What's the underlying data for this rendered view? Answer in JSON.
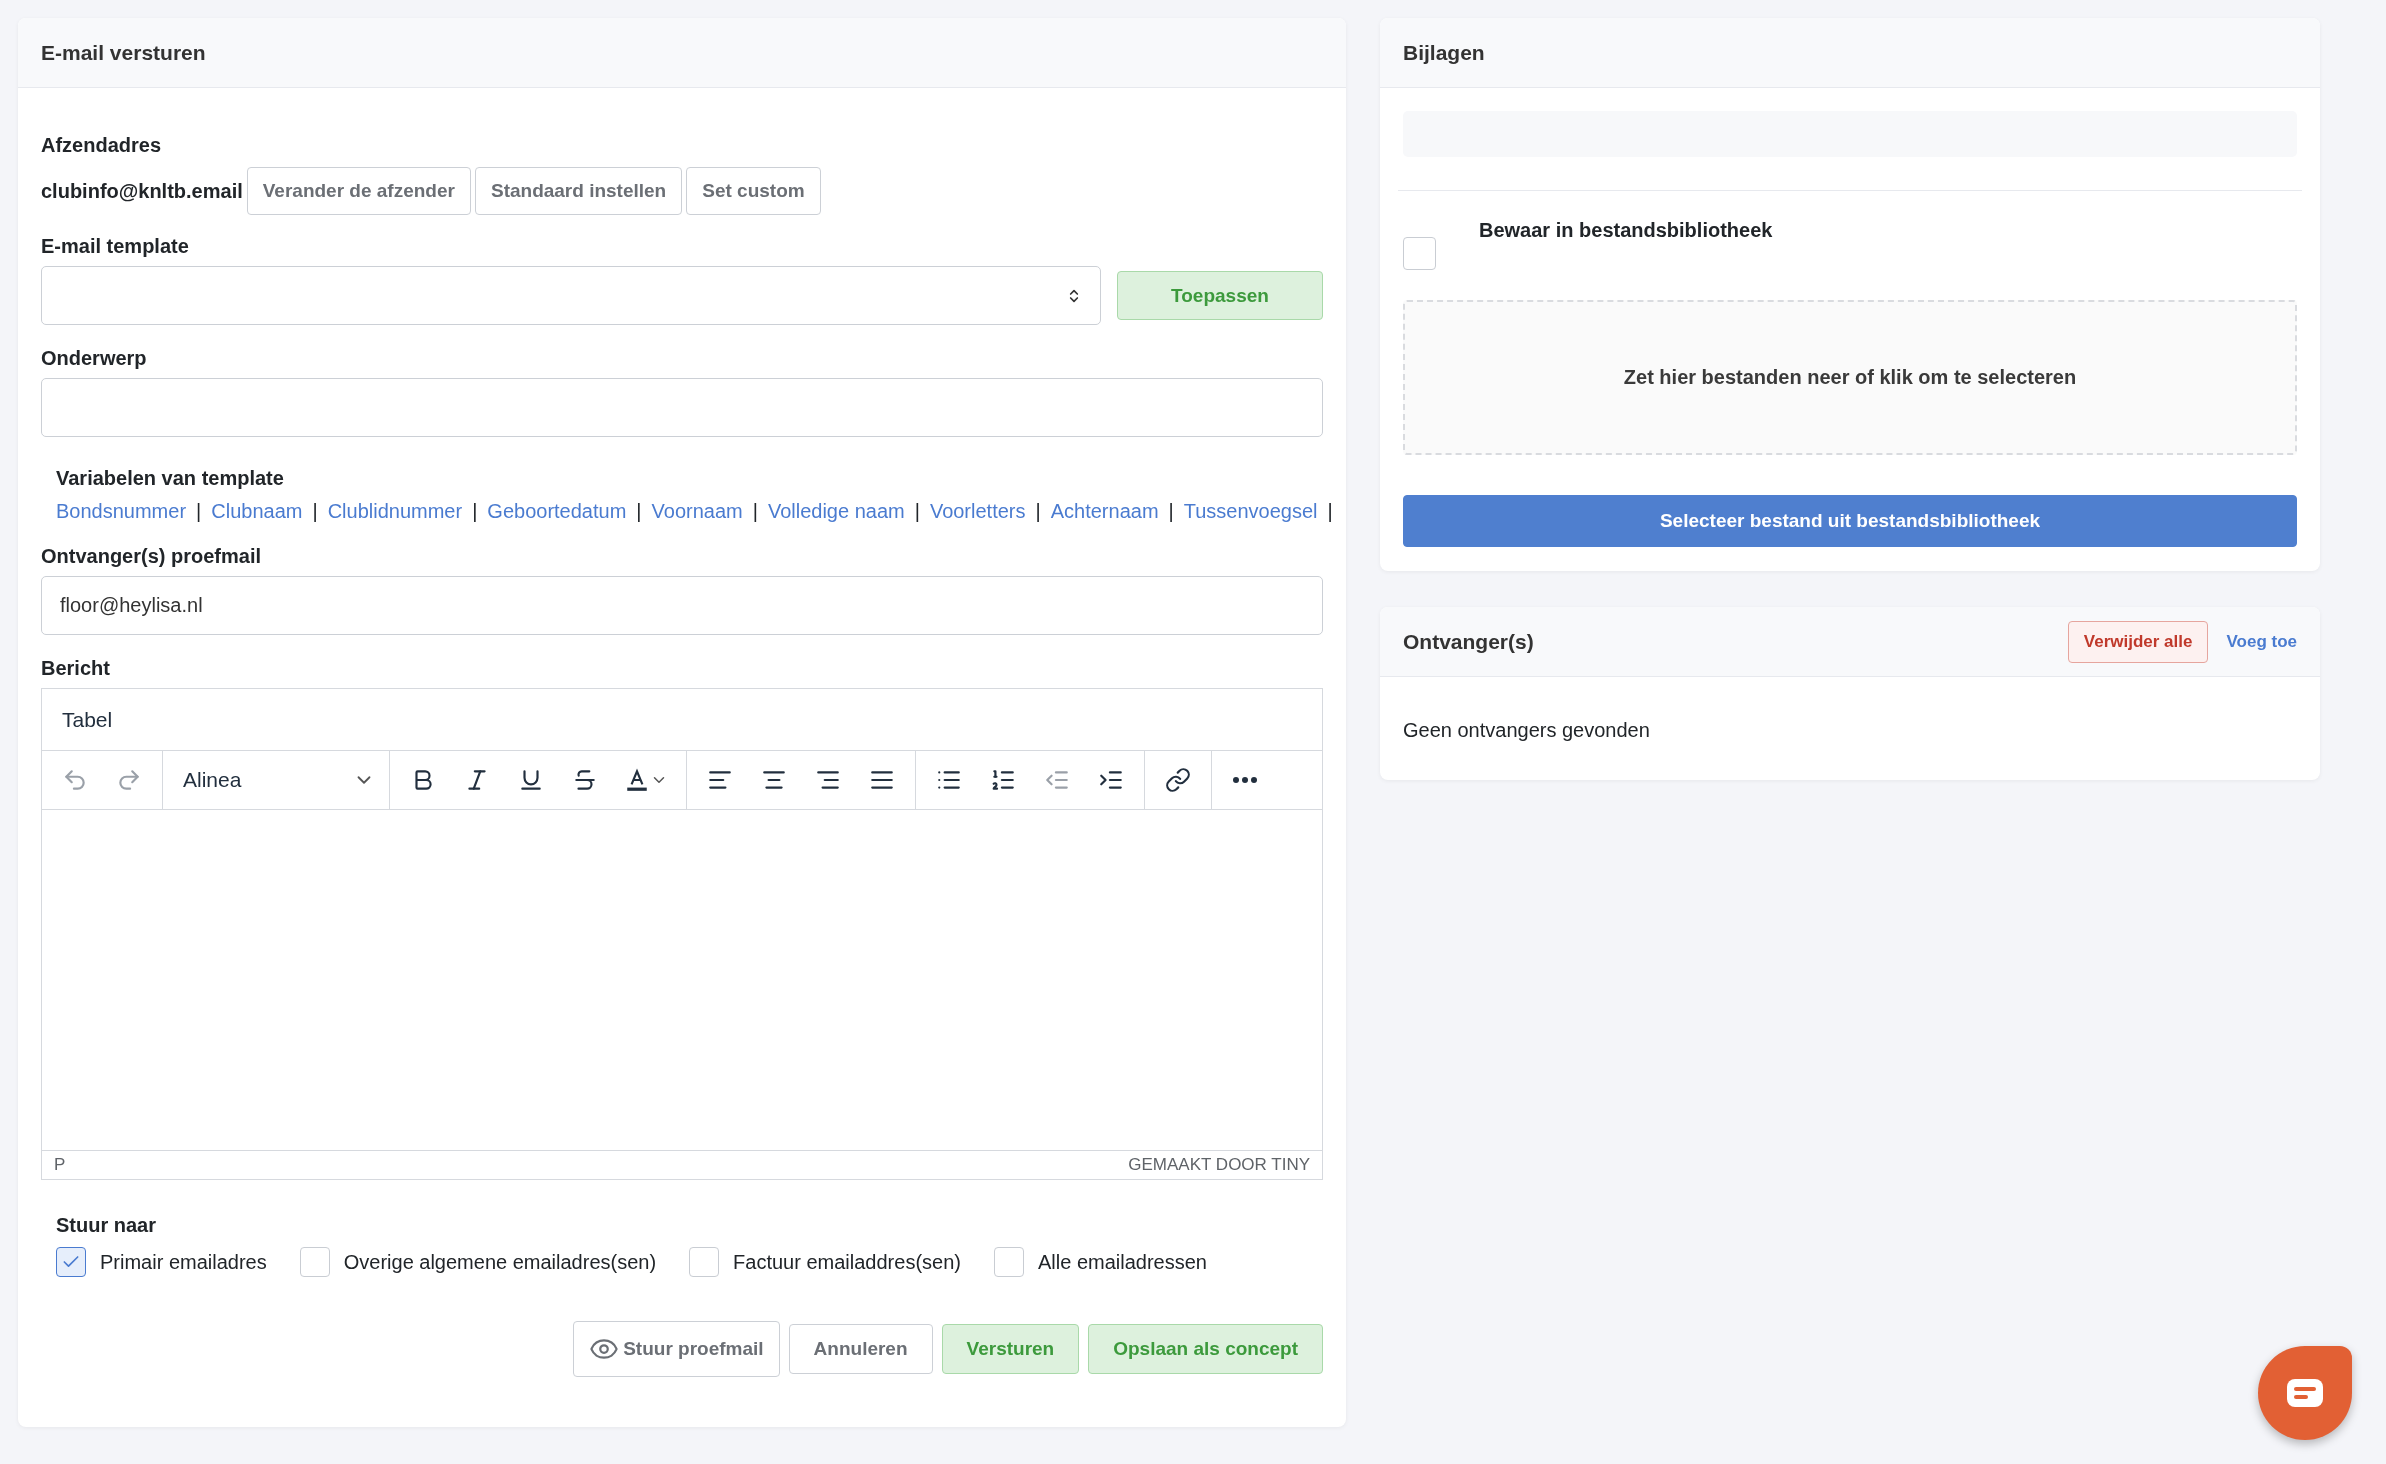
{
  "email_card": {
    "title": "E-mail versturen",
    "sender": {
      "label": "Afzendadres",
      "address": "clubinfo@knltb.email",
      "buttons": [
        "Verander de afzender",
        "Standaard instellen",
        "Set custom"
      ]
    },
    "template": {
      "label": "E-mail template",
      "apply_button": "Toepassen"
    },
    "subject": {
      "label": "Onderwerp"
    },
    "variables": {
      "title": "Variabelen van template",
      "items": [
        "Bondsnummer",
        "Clubnaam",
        "Clublidnummer",
        "Geboortedatum",
        "Voornaam",
        "Volledige naam",
        "Voorletters",
        "Achternaam",
        "Tussenvoegsel"
      ],
      "separator": "|"
    },
    "test_recipient": {
      "label": "Ontvanger(s) proefmail",
      "value": "floor@heylisa.nl"
    },
    "message": {
      "label": "Bericht",
      "menu": [
        "Tabel"
      ],
      "block_format": "Alinea",
      "status_path": "P",
      "branding": "GEMAAKT DOOR TINY"
    },
    "send_to": {
      "label": "Stuur naar",
      "options": [
        {
          "label": "Primair emailadres",
          "checked": true
        },
        {
          "label": "Overige algemene emailadres(sen)",
          "checked": false
        },
        {
          "label": "Factuur emailaddres(sen)",
          "checked": false
        },
        {
          "label": "Alle emailadressen",
          "checked": false
        }
      ]
    },
    "actions": [
      {
        "label": "Stuur proefmail",
        "kind": "preview"
      },
      {
        "label": "Annuleren",
        "kind": "default"
      },
      {
        "label": "Versturen",
        "kind": "success"
      },
      {
        "label": "Opslaan als concept",
        "kind": "success"
      }
    ]
  },
  "attachments": {
    "title": "Bijlagen",
    "save_to_library": {
      "label": "Bewaar in bestandsbibliotheek",
      "checked": false
    },
    "dropzone": "Zet hier bestanden neer of klik om te selecteren",
    "library_button": "Selecteer bestand uit bestandsbibliotheek"
  },
  "recipients": {
    "title": "Ontvanger(s)",
    "remove_all": "Verwijder alle",
    "add": "Voeg toe",
    "empty": "Geen ontvangers gevonden"
  }
}
